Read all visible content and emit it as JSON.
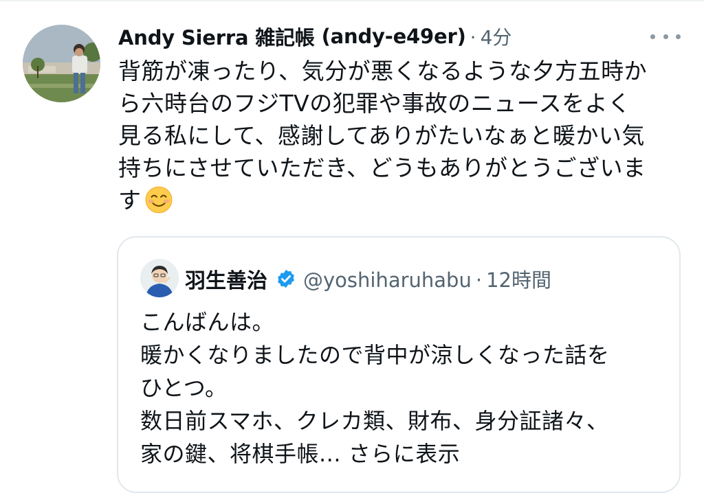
{
  "tweet": {
    "display_name": "Andy Sierra 雑記帳",
    "handle": "(andy-e49er)",
    "separator": "·",
    "time": "4分",
    "text_lines": [
      "背筋が凍ったり、気分が悪くなるような夕方五時か",
      "ら六時台のフジTVの犯罪や事故のニュースをよく",
      "見る私にして、感謝してありがたいなぁと暖かい気",
      "持ちにさせていただき、どうもありがとうございま",
      "す"
    ],
    "emoji": "smiling-face-emoji"
  },
  "quote": {
    "display_name": "羽生善治",
    "handle": "@yoshiharuhabu",
    "separator": "·",
    "time": "12時間",
    "verified_icon": "verified-badge-icon",
    "verified_color": "#1d9bf0",
    "text_lines": [
      "こんばんは。",
      "暖かくなりましたので背中が涼しくなった話を",
      "ひとつ。",
      "数日前スマホ、クレカ類、財布、身分証諸々、",
      "家の鍵、将棋手帳..."
    ],
    "show_more": "さらに表示"
  },
  "colors": {
    "text": "#0f1419",
    "secondary": "#536471",
    "border": "#e1e8ed"
  }
}
